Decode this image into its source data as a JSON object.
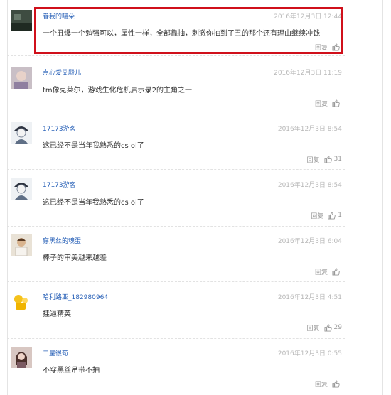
{
  "comments": [
    {
      "username": "眷我的喵朵",
      "time": "2016年12月3日 12:44",
      "text": "一个丑爆一个勉强可以，属性一样，全部靠抽，刺激你抽到了丑的那个还有理由继续冲钱",
      "reply_label": "回复",
      "likes": "",
      "avatar": "dark-landscape-avatar",
      "highlighted": true
    },
    {
      "username": "点心爱艾殿儿",
      "time": "2016年12月3日 11:19",
      "text": "tm像克莱尔，游戏生化危机启示录2的主角之一",
      "reply_label": "回复",
      "likes": "",
      "avatar": "portrait-avatar"
    },
    {
      "username": "17173游客",
      "time": "2016年12月3日 8:54",
      "text": "这已经不是当年我熟悉的cs ol了",
      "reply_label": "回复",
      "likes": "31",
      "avatar": "default-guest-avatar"
    },
    {
      "username": "17173游客",
      "time": "2016年12月3日 8:54",
      "text": "这已经不是当年我熟悉的cs ol了",
      "reply_label": "回复",
      "likes": "1",
      "avatar": "default-guest-avatar"
    },
    {
      "username": "穿黑丝的魂蛋",
      "time": "2016年12月3日 6:04",
      "text": "棒子的审美越来越差",
      "reply_label": "回复",
      "likes": "",
      "avatar": "character-avatar"
    },
    {
      "username": "哈利路亚_182980964",
      "time": "2016年12月3日 4:51",
      "text": "挂逼精英",
      "reply_label": "回复",
      "likes": "29",
      "avatar": "yellow-figure-avatar"
    },
    {
      "username": "二皇很苟",
      "time": "2016年12月3日 0:55",
      "text": "不穿黑丝吊带不抽",
      "reply_label": "回复",
      "likes": "",
      "avatar": "girl-portrait-avatar"
    }
  ],
  "colors": {
    "username": "#2a62b8",
    "highlight_border": "#d0101b",
    "timestamp": "#b8b8b8"
  }
}
